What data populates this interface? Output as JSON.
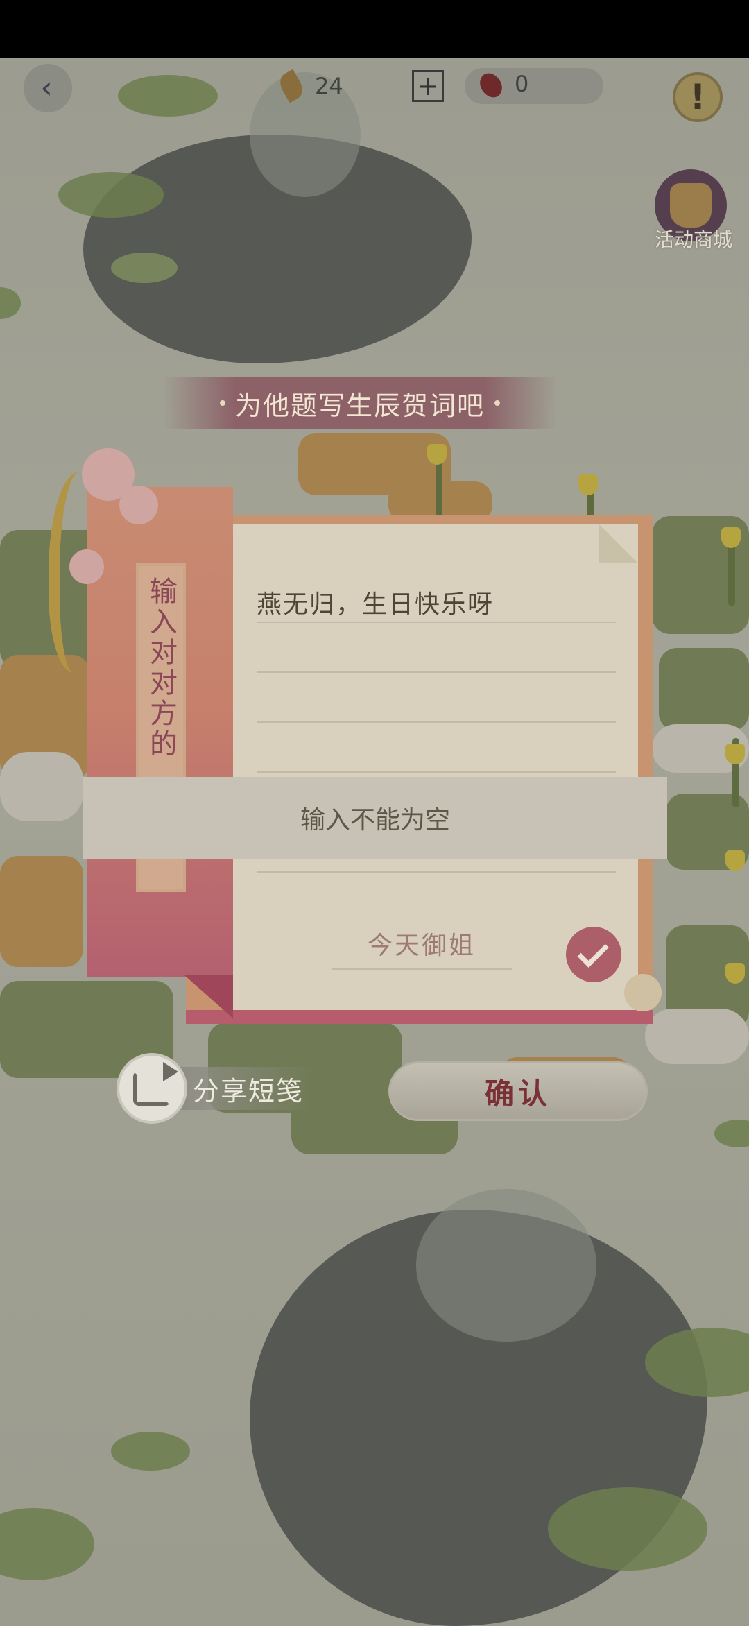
{
  "topbar": {
    "back_icon": "back-arrow-icon",
    "quill_count": "24",
    "plus_label": "+",
    "token_count": "0",
    "info_label": "!",
    "shop_label": "活动商城"
  },
  "banner": {
    "title": "为他题写生辰贺词吧"
  },
  "card": {
    "side_title": "输入对对方的",
    "message": "燕无归，生日快乐呀",
    "author": "今天御姐"
  },
  "toast": {
    "text": "输入不能为空"
  },
  "actions": {
    "share_label": "分享短笺",
    "confirm_label": "确认"
  },
  "colors": {
    "accent_red": "#7b3036",
    "panel_pink": "#c6806c",
    "paper": "#d9d1bd"
  }
}
